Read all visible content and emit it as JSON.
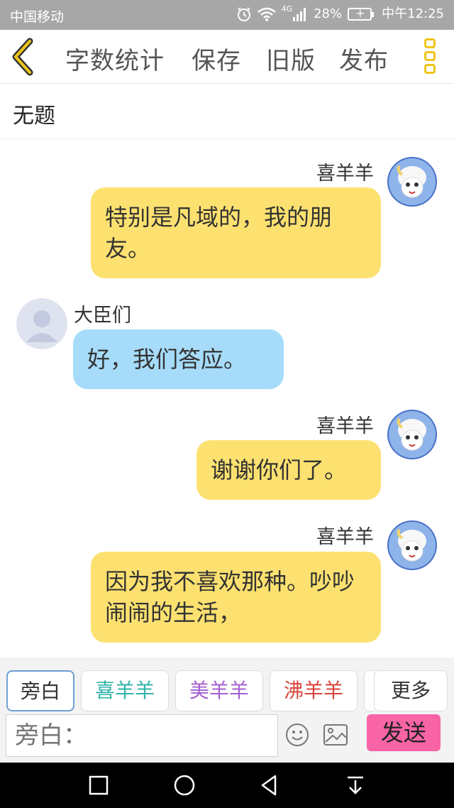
{
  "status_bar": {
    "carrier": "中国移动",
    "alarm_icon": "alarm-icon",
    "wifi_icon": "wifi-icon",
    "signal_label": "4G",
    "battery": "28%",
    "time": "中午12:25"
  },
  "toolbar": {
    "back_icon": "chevron-left-icon",
    "word_count": "字数统计",
    "save": "保存",
    "old_version": "旧版",
    "publish": "发布",
    "more_icon": "more-vertical-icon"
  },
  "document": {
    "title": "无题"
  },
  "messages": [
    {
      "side": "right",
      "speaker": "喜羊羊",
      "text": "特别是凡域的，我的朋友。",
      "color": "#fde170"
    },
    {
      "side": "left",
      "speaker": "大臣们",
      "text": "好，我们答应。",
      "color": "#a6dcfa"
    },
    {
      "side": "right",
      "speaker": "喜羊羊",
      "text": "谢谢你们了。",
      "color": "#fde170"
    },
    {
      "side": "right",
      "speaker": "喜羊羊",
      "text": "因为我不喜欢那种。吵吵闹闹的生活，",
      "color": "#fde170"
    }
  ],
  "roles": [
    {
      "label": "旁白",
      "color": "#333333",
      "active": true
    },
    {
      "label": "喜羊羊",
      "color": "#2fb3a8",
      "active": false
    },
    {
      "label": "美羊羊",
      "color": "#a55fd0",
      "active": false
    },
    {
      "label": "沸羊羊",
      "color": "#d9443a",
      "active": false
    },
    {
      "label": "更多",
      "color": "#333333",
      "active": false
    }
  ],
  "composer": {
    "placeholder": "旁白：",
    "emoji_icon": "emoji-icon",
    "image_icon": "image-icon",
    "send": "发送"
  },
  "nav": {
    "square": "recent-apps-icon",
    "circle": "home-icon",
    "triangle": "back-icon",
    "down": "notification-pull-icon"
  }
}
